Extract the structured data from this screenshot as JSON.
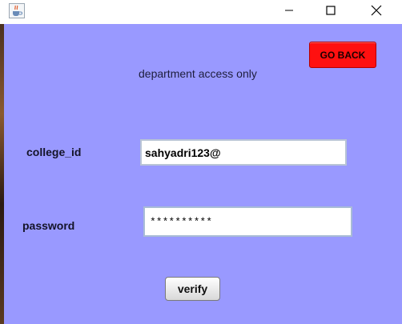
{
  "window": {
    "icon": "java-cup-icon",
    "controls": {
      "minimize_icon": "minimize-icon",
      "maximize_icon": "maximize-icon",
      "close_icon": "close-icon"
    }
  },
  "colors": {
    "background": "#9999ff",
    "go_back_button": "#ff1010",
    "titlebar": "#ffffff"
  },
  "header": {
    "go_back_label": "GO BACK",
    "subtitle": "department access only"
  },
  "form": {
    "college_id_label": "college_id",
    "college_id_value": "sahyadri123@",
    "password_label": "password",
    "password_value": "**********",
    "verify_label": "verify"
  }
}
